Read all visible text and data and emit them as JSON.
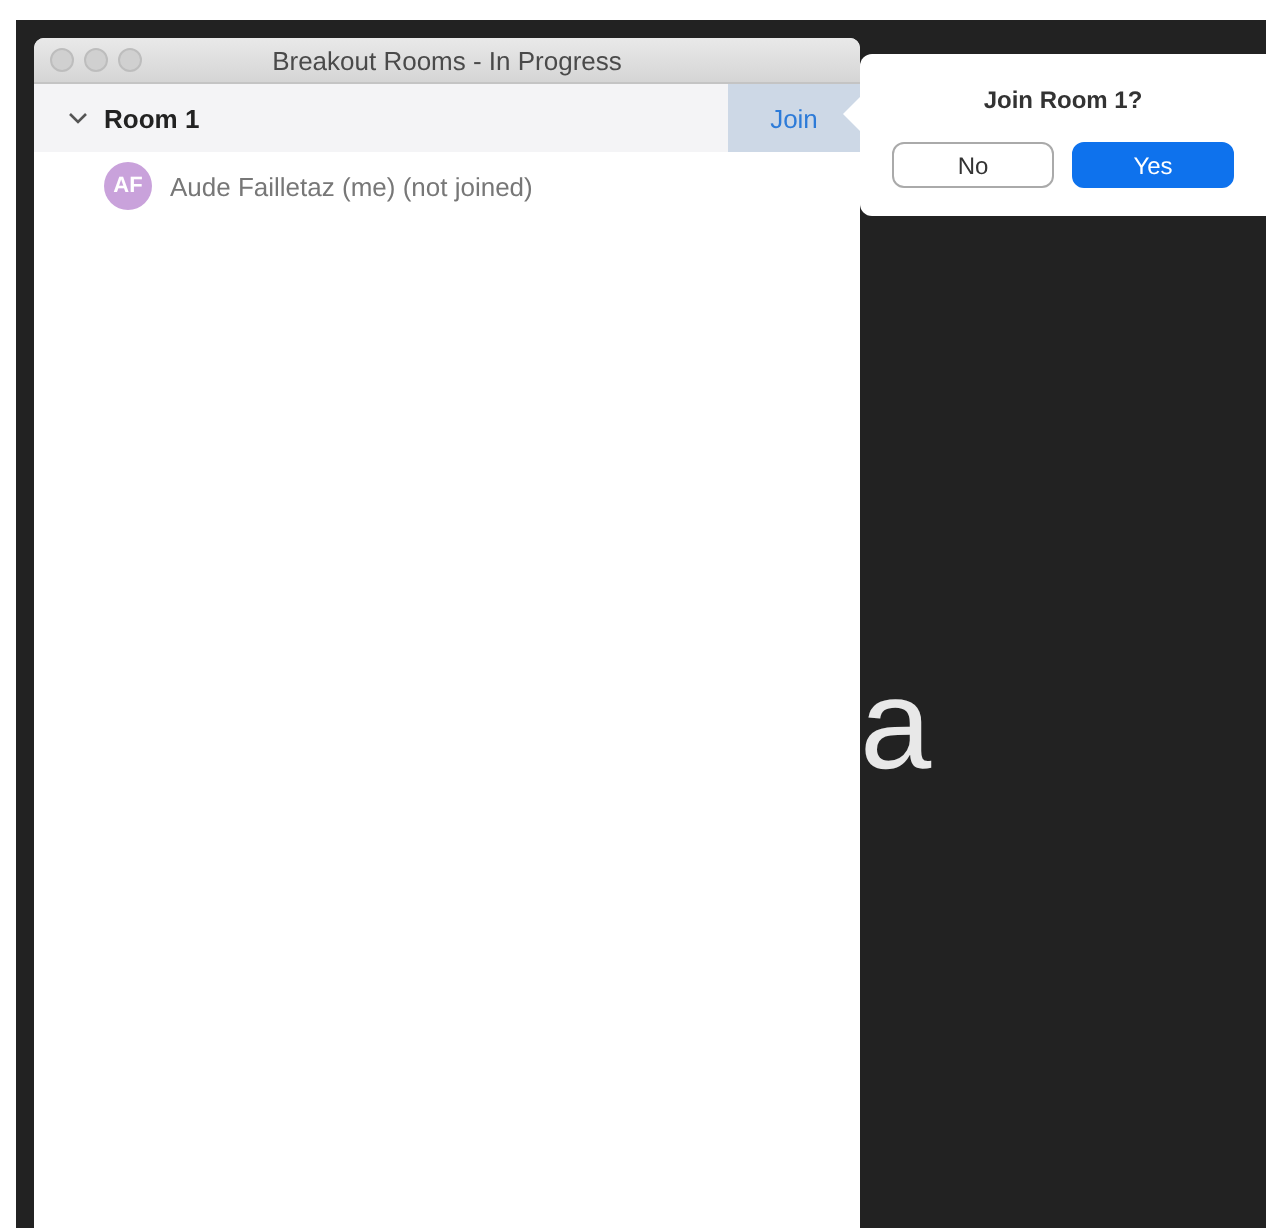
{
  "window": {
    "title": "Breakout Rooms - In Progress"
  },
  "rooms": [
    {
      "name": "Room 1",
      "expanded": true,
      "join_label": "Join",
      "members": [
        {
          "initials": "AF",
          "name": "Aude Failletaz (me) (not joined)",
          "color": "#c9a2db"
        }
      ]
    }
  ],
  "popover": {
    "title": "Join Room 1?",
    "buttons": [
      {
        "label": "No",
        "kind": "secondary"
      },
      {
        "label": "Yes",
        "kind": "primary"
      }
    ]
  },
  "background_text": "a"
}
